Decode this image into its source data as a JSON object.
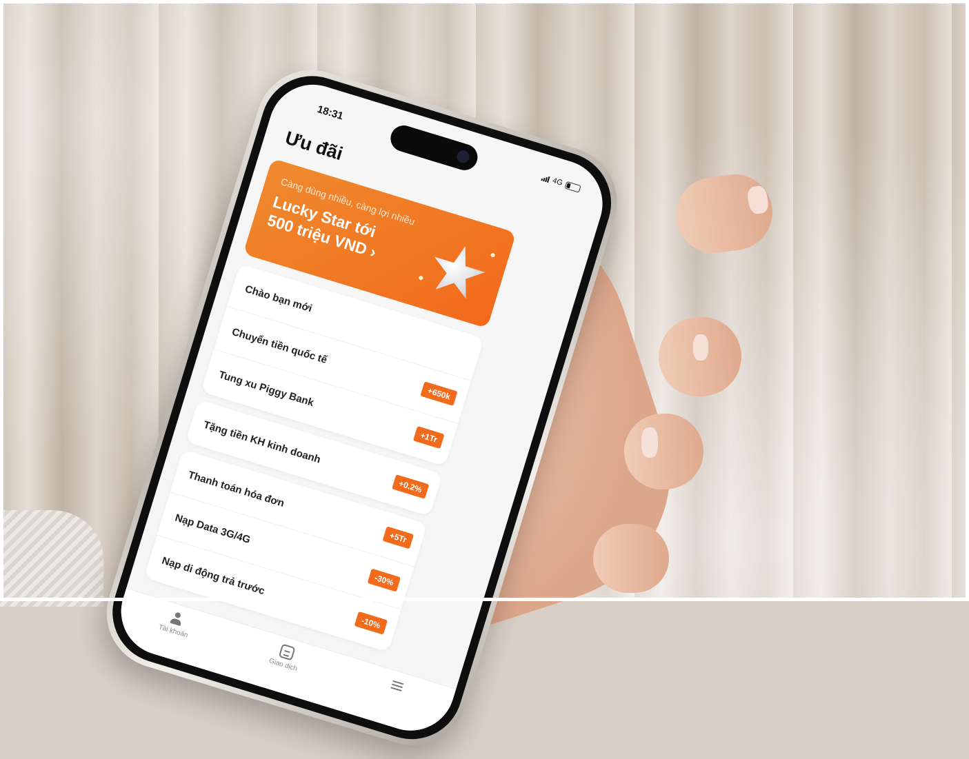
{
  "status_bar": {
    "time": "18:31",
    "network": "4G"
  },
  "page": {
    "title": "Ưu đãi"
  },
  "banner": {
    "subtitle": "Càng dùng nhiều, càng lợi nhiều",
    "headline_line1": "Lucky Star tới",
    "headline_line2": "500 triệu VND ›",
    "color": "#f26a1b"
  },
  "offers": [
    {
      "label": "Chào bạn mới",
      "badge": ""
    },
    {
      "label": "Chuyển tiền quốc tế",
      "badge": "+650k"
    },
    {
      "label": "Tung xu Piggy Bank",
      "badge": "+1Tr"
    },
    {
      "label": "Tặng tiền KH kinh doanh",
      "badge": "+0.2%"
    },
    {
      "label": "Thanh toán hóa đơn",
      "badge": "+5Tr"
    },
    {
      "label": "Nạp Data 3G/4G",
      "badge": "-30%"
    },
    {
      "label": "Nạp di động trả trước",
      "badge": "-10%"
    }
  ],
  "tabbar": {
    "tabs": [
      {
        "label": "Tài khoản",
        "icon": "user-icon"
      },
      {
        "label": "Giao dịch",
        "icon": "transaction-icon"
      },
      {
        "label": "",
        "icon": "menu-icon"
      }
    ]
  },
  "colors": {
    "accent": "#f26a1b",
    "screen_bg": "#f6f6f7"
  }
}
